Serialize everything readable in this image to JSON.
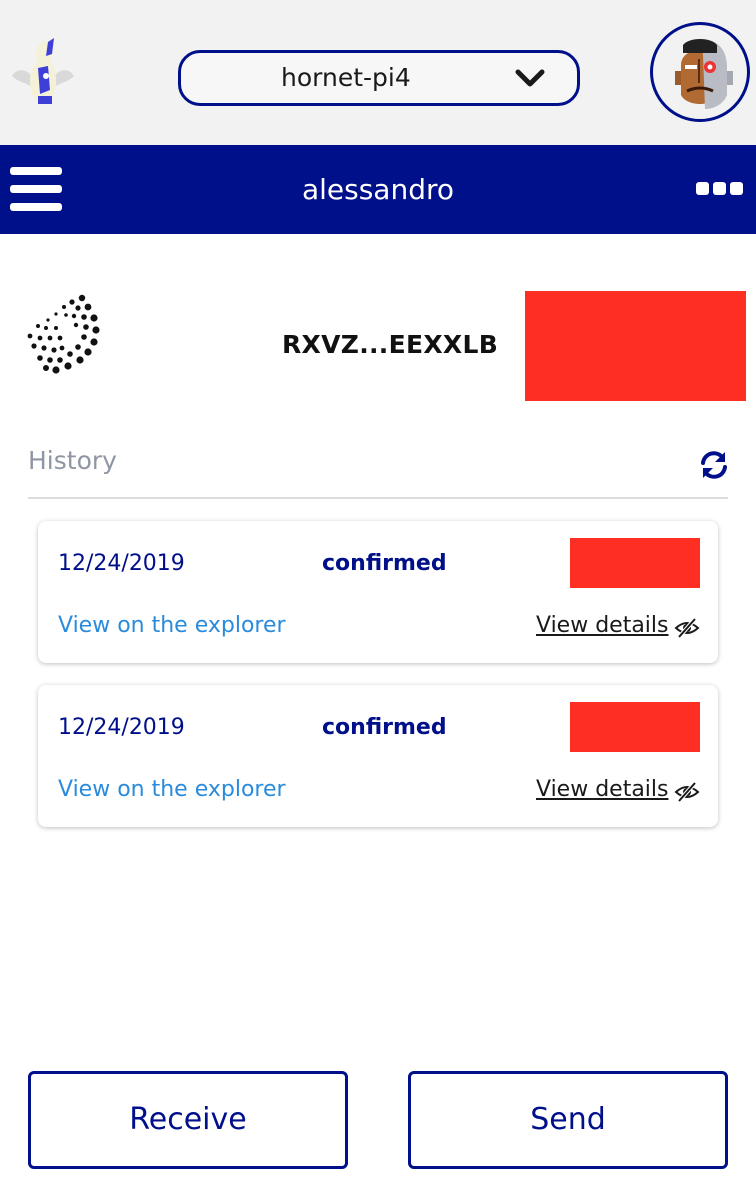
{
  "header": {
    "network": "hornet-pi4",
    "username": "alessandro"
  },
  "icons": {
    "app_logo": "app-logo-icon",
    "network_dropdown": "chevron-down-icon",
    "avatar": "avatar-icon",
    "menu": "hamburger-menu-icon",
    "more": "more-options-icon",
    "token": "iota-logo-icon",
    "refresh": "refresh-icon",
    "details": "eye-slash-icon"
  },
  "account": {
    "address": "RXVZ...EEXXLB"
  },
  "history": {
    "title": "History",
    "transactions": [
      {
        "date": "12/24/2019",
        "status": "confirmed",
        "explorer_link": "View on the explorer",
        "details_link": "View details"
      },
      {
        "date": "12/24/2019",
        "status": "confirmed",
        "explorer_link": "View on the explorer",
        "details_link": "View details"
      }
    ]
  },
  "actions": {
    "receive": "Receive",
    "send": "Send"
  },
  "colors": {
    "brand": "#000f8a",
    "link": "#2a8bdc",
    "redacted": "#ff2e22",
    "topbar_bg": "#f2f2f2",
    "muted": "#8f96a3"
  }
}
